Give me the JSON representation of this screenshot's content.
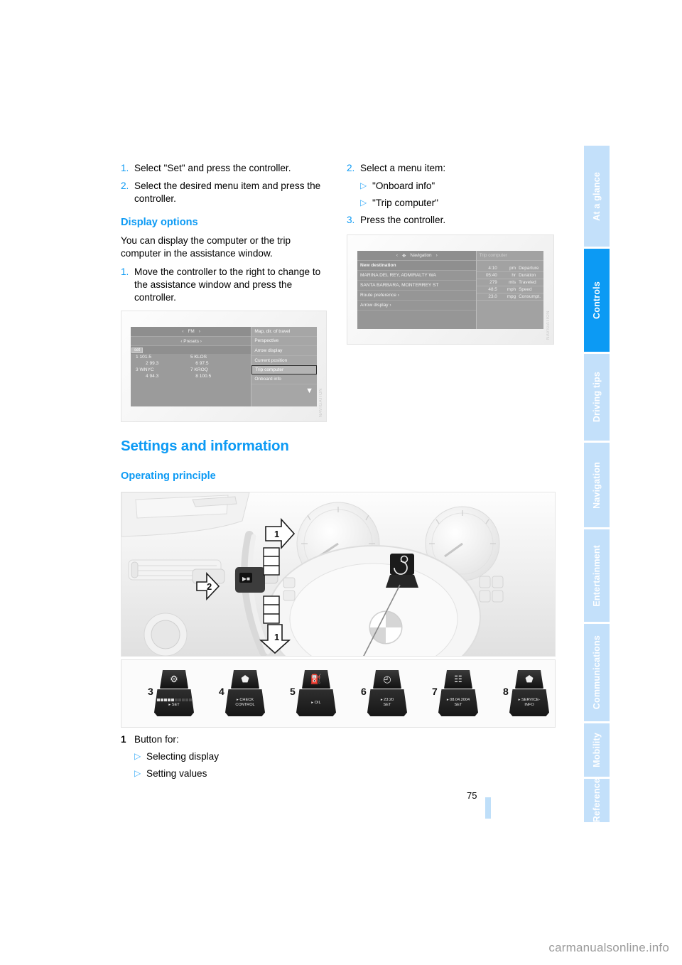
{
  "page": {
    "number": "75",
    "watermark": "carmanualsonline.info"
  },
  "sidebar": {
    "tabs": [
      {
        "label": "At a glance",
        "active": false
      },
      {
        "label": "Controls",
        "active": true
      },
      {
        "label": "Driving tips",
        "active": false
      },
      {
        "label": "Navigation",
        "active": false
      },
      {
        "label": "Entertainment",
        "active": false
      },
      {
        "label": "Communications",
        "active": false
      },
      {
        "label": "Mobility",
        "active": false
      },
      {
        "label": "Reference",
        "active": false
      }
    ],
    "active_color": "#0c9af4",
    "inactive_color": "#c3e0fa"
  },
  "left_column": {
    "steps_top": [
      {
        "num": "1.",
        "text": "Select \"Set\" and press the controller."
      },
      {
        "num": "2.",
        "text": "Select the desired menu item and press the controller."
      }
    ],
    "display_options": {
      "heading": "Display options",
      "intro": "You can display the computer or the trip computer in the assistance window.",
      "steps": [
        {
          "num": "1.",
          "text": "Move the controller to the right to change to the assistance window and press the controller."
        }
      ]
    },
    "figure_radio": {
      "header_label": "FM",
      "presets_label": "‹ Presets ›",
      "set_label": "set",
      "stations": [
        {
          "left_num": "1",
          "left": "101.5",
          "right_num": "5",
          "right": "KLOS"
        },
        {
          "left_num": "2",
          "left": "99.3",
          "right_num": "6",
          "right": "97.5"
        },
        {
          "left_num": "3",
          "left": "WNYC",
          "right_num": "7",
          "right": "KROQ"
        },
        {
          "left_num": "4",
          "left": "94.3",
          "right_num": "8",
          "right": "100.5"
        }
      ],
      "menu": [
        {
          "label": "Map, dir. of travel",
          "selected": false
        },
        {
          "label": "Perspective",
          "selected": false
        },
        {
          "label": "Arrow display",
          "selected": false
        },
        {
          "label": "Current position",
          "selected": false
        },
        {
          "label": "Trip computer",
          "selected": true
        },
        {
          "label": "Onboard info",
          "selected": false
        }
      ]
    }
  },
  "right_column": {
    "steps": [
      {
        "num": "2.",
        "text": "Select a menu item:"
      },
      {
        "num": "3.",
        "text": "Press the controller."
      }
    ],
    "bullets": [
      "\"Onboard info\"",
      "\"Trip computer\""
    ],
    "figure_nav": {
      "title": "Navigation",
      "panel_title": "Trip computer",
      "items": [
        {
          "label": "New destination",
          "type": "header"
        },
        {
          "label": "MARINA DEL REY, ADMIRALTY WA",
          "type": "entry"
        },
        {
          "label": "SANTA BARBARA, MONTERREY ST",
          "type": "entry"
        },
        {
          "label": "Route preference ›",
          "type": "entry"
        },
        {
          "label": "Arrow display ›",
          "type": "entry"
        }
      ],
      "trip_rows": [
        {
          "value": "4:10",
          "unit": "pm",
          "label": "Departure"
        },
        {
          "value": "05:40",
          "unit": "hr",
          "label": "Duration"
        },
        {
          "value": "279",
          "unit": "mls",
          "label": "Traveled"
        },
        {
          "value": "48.5",
          "unit": "mph",
          "label": "Speed"
        },
        {
          "value": "23.0",
          "unit": "mpg",
          "label": "Consumpt."
        }
      ]
    }
  },
  "section": {
    "title": "Settings and information",
    "subtitle": "Operating principle"
  },
  "diagram": {
    "callouts": [
      {
        "id": "1",
        "position": "top"
      },
      {
        "id": "2",
        "position": "left"
      },
      {
        "id": "1",
        "position": "bottom"
      }
    ],
    "buttons": [
      {
        "num": "3",
        "icon": "engine-settings-icon",
        "label": "SET",
        "indicator": "bars"
      },
      {
        "num": "4",
        "icon": "car-icon",
        "label": "CHECK\nCONTROL",
        "indicator": "arrow"
      },
      {
        "num": "5",
        "icon": "oil-can-icon",
        "label": "OIL",
        "indicator": "arrow"
      },
      {
        "num": "6",
        "icon": "clock-icon",
        "label": "23:20\nSET",
        "indicator": "arrow"
      },
      {
        "num": "7",
        "icon": "date-icon",
        "label": "08.04.2004\nSET",
        "indicator": "arrow"
      },
      {
        "num": "8",
        "icon": "car-icon",
        "label": "SERVICE-\nINFO",
        "indicator": "arrow"
      }
    ],
    "legend": {
      "num": "1",
      "title": "Button for:",
      "items": [
        "Selecting display",
        "Setting values"
      ]
    }
  }
}
